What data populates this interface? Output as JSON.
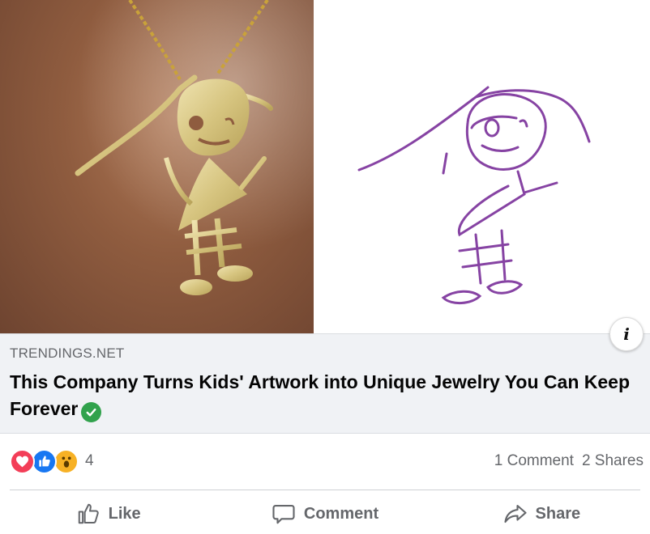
{
  "link_preview": {
    "domain": "TRENDINGS.NET",
    "title": "This Company Turns Kids' Artwork into Unique Jewelry You Can Keep Forever"
  },
  "reactions": {
    "types": [
      "love",
      "like",
      "wow"
    ],
    "count": "4"
  },
  "stats": {
    "comments": "1 Comment",
    "shares": "2 Shares"
  },
  "actions": {
    "like_label": "Like",
    "comment_label": "Comment",
    "share_label": "Share"
  },
  "icons": {
    "info": "info-icon",
    "verified": "verified-check-icon",
    "like": "thumbs-up-icon",
    "comment": "comment-bubble-icon",
    "share": "share-arrow-icon"
  },
  "colors": {
    "love": "#f33e58",
    "like": "#1877f2",
    "wow": "#f7b125",
    "verified": "#31a24c",
    "muted_text": "#65676b",
    "preview_bg": "#f0f2f5"
  }
}
